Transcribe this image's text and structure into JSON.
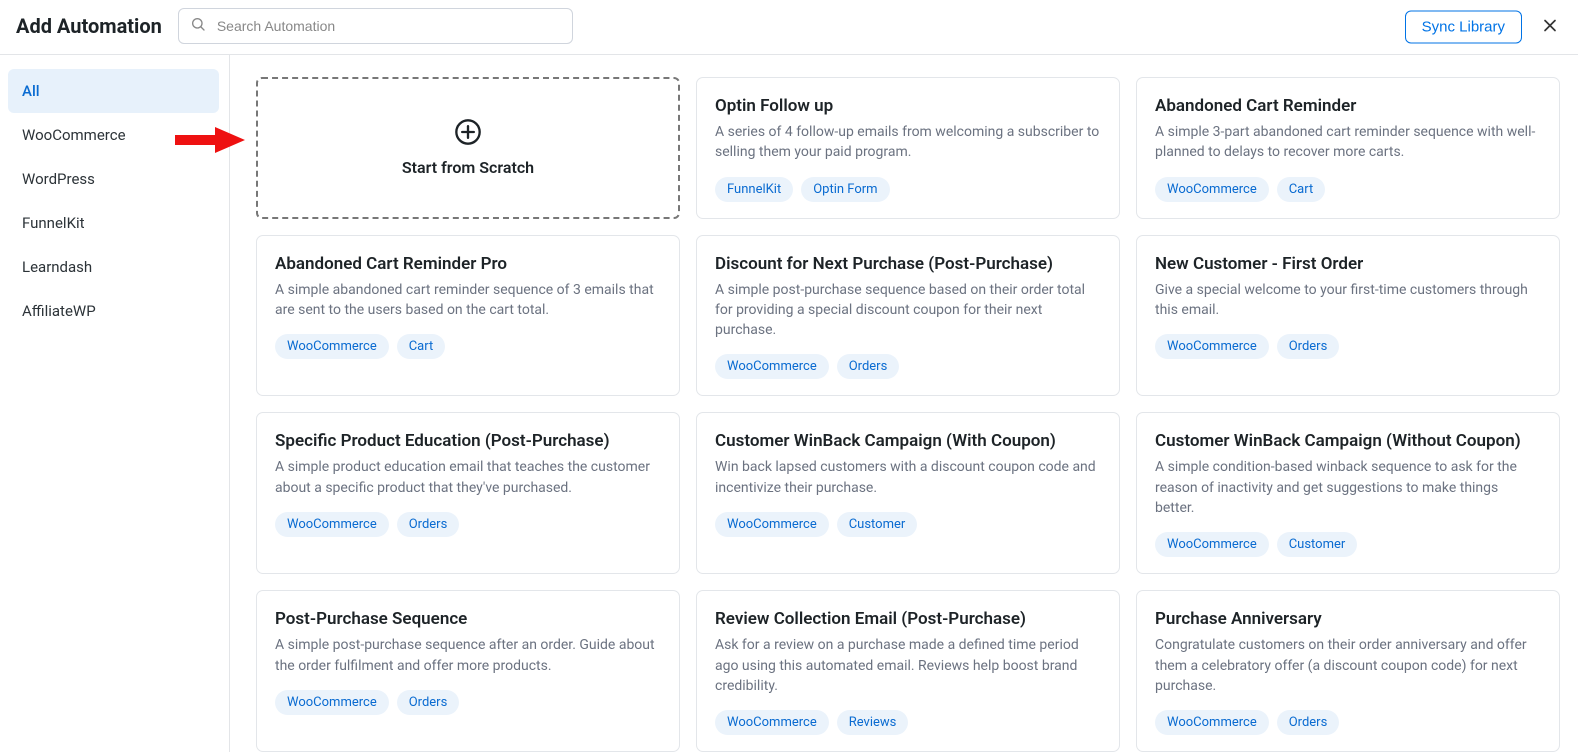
{
  "header": {
    "title": "Add Automation",
    "search_placeholder": "Search Automation",
    "sync_label": "Sync Library"
  },
  "sidebar": {
    "items": [
      {
        "label": "All",
        "active": true
      },
      {
        "label": "WooCommerce",
        "active": false
      },
      {
        "label": "WordPress",
        "active": false
      },
      {
        "label": "FunnelKit",
        "active": false
      },
      {
        "label": "Learndash",
        "active": false
      },
      {
        "label": "AffiliateWP",
        "active": false
      }
    ]
  },
  "scratch": {
    "label": "Start from Scratch"
  },
  "cards": [
    {
      "title": "Optin Follow up",
      "desc": "A series of 4 follow-up emails from welcoming a subscriber to selling them your paid program.",
      "tags": [
        "FunnelKit",
        "Optin Form"
      ]
    },
    {
      "title": "Abandoned Cart Reminder",
      "desc": "A simple 3-part abandoned cart reminder sequence with well-planned to delays to recover more carts.",
      "tags": [
        "WooCommerce",
        "Cart"
      ]
    },
    {
      "title": "Abandoned Cart Reminder Pro",
      "desc": "A simple abandoned cart reminder sequence of 3 emails that are sent to the users based on the cart total.",
      "tags": [
        "WooCommerce",
        "Cart"
      ]
    },
    {
      "title": "Discount for Next Purchase (Post-Purchase)",
      "desc": "A simple post-purchase sequence based on their order total for providing a special discount coupon for their next purchase.",
      "tags": [
        "WooCommerce",
        "Orders"
      ]
    },
    {
      "title": "New Customer - First Order",
      "desc": "Give a special welcome to your first-time customers through this email.",
      "tags": [
        "WooCommerce",
        "Orders"
      ]
    },
    {
      "title": "Specific Product Education (Post-Purchase)",
      "desc": "A simple product education email that teaches the customer about a specific product that they've purchased.",
      "tags": [
        "WooCommerce",
        "Orders"
      ]
    },
    {
      "title": "Customer WinBack Campaign (With Coupon)",
      "desc": "Win back lapsed customers with a discount coupon code and incentivize their purchase.",
      "tags": [
        "WooCommerce",
        "Customer"
      ]
    },
    {
      "title": "Customer WinBack Campaign (Without Coupon)",
      "desc": "A simple condition-based winback sequence to ask for the reason of inactivity and get suggestions to make things better.",
      "tags": [
        "WooCommerce",
        "Customer"
      ]
    },
    {
      "title": "Post-Purchase Sequence",
      "desc": "A simple post-purchase sequence after an order. Guide about the order fulfilment and offer more products.",
      "tags": [
        "WooCommerce",
        "Orders"
      ]
    },
    {
      "title": "Review Collection Email (Post-Purchase)",
      "desc": "Ask for a review on a purchase made a defined time period ago using this automated email. Reviews help boost brand credibility.",
      "tags": [
        "WooCommerce",
        "Reviews"
      ]
    },
    {
      "title": "Purchase Anniversary",
      "desc": "Congratulate customers on their order anniversary and offer them a celebratory offer (a discount coupon code) for next purchase.",
      "tags": [
        "WooCommerce",
        "Orders"
      ]
    }
  ]
}
